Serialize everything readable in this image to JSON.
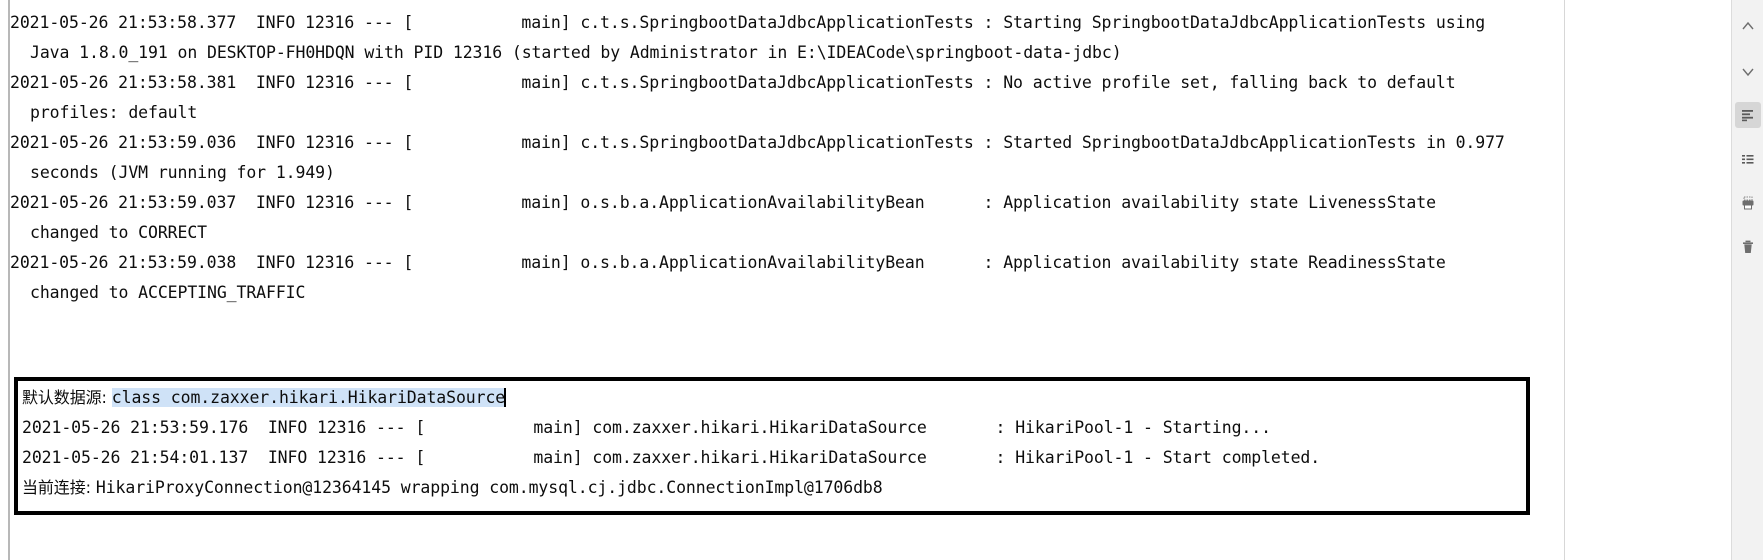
{
  "console": {
    "lines": [
      {
        "text": "2021-05-26 21:53:58.377  INFO 12316 --- [           main] c.t.s.SpringbootDataJdbcApplicationTests : Starting SpringbootDataJdbcApplicationTests using",
        "indent": false
      },
      {
        "text": "Java 1.8.0_191 on DESKTOP-FH0HDQN with PID 12316 (started by Administrator in E:\\IDEACode\\springboot-data-jdbc)",
        "indent": true
      },
      {
        "text": "2021-05-26 21:53:58.381  INFO 12316 --- [           main] c.t.s.SpringbootDataJdbcApplicationTests : No active profile set, falling back to default",
        "indent": false
      },
      {
        "text": "profiles: default",
        "indent": true
      },
      {
        "text": "2021-05-26 21:53:59.036  INFO 12316 --- [           main] c.t.s.SpringbootDataJdbcApplicationTests : Started SpringbootDataJdbcApplicationTests in 0.977",
        "indent": false
      },
      {
        "text": "seconds (JVM running for 1.949)",
        "indent": true
      },
      {
        "text": "2021-05-26 21:53:59.037  INFO 12316 --- [           main] o.s.b.a.ApplicationAvailabilityBean      : Application availability state LivenessState",
        "indent": false
      },
      {
        "text": "changed to CORRECT",
        "indent": true
      },
      {
        "text": "2021-05-26 21:53:59.038  INFO 12316 --- [           main] o.s.b.a.ApplicationAvailabilityBean      : Application availability state ReadinessState",
        "indent": false
      },
      {
        "text": "changed to ACCEPTING_TRAFFIC",
        "indent": true
      }
    ]
  },
  "boxed": {
    "datasource_label": "默认数据源: ",
    "datasource_value": "class com.zaxxer.hikari.HikariDataSource",
    "lines": [
      {
        "text": "2021-05-26 21:53:59.176  INFO 12316 --- [           main] com.zaxxer.hikari.HikariDataSource       : HikariPool-1 - Starting..."
      },
      {
        "text": "2021-05-26 21:54:01.137  INFO 12316 --- [           main] com.zaxxer.hikari.HikariDataSource       : HikariPool-1 - Start completed."
      }
    ],
    "connection_label": "当前连接: ",
    "connection_value": "HikariProxyConnection@12364145 wrapping com.mysql.cj.jdbc.ConnectionImpl@1706db8"
  },
  "toolbar": {
    "buttons": [
      {
        "name": "scroll-up-icon",
        "title": "Up the Stack Trace"
      },
      {
        "name": "scroll-down-icon",
        "title": "Down the Stack Trace"
      },
      {
        "name": "soft-wrap-icon",
        "title": "Soft-Wrap",
        "active": true
      },
      {
        "name": "list-lines-icon",
        "title": "Use Console Input"
      },
      {
        "name": "print-icon",
        "title": "Print"
      },
      {
        "name": "trash-icon",
        "title": "Clear All"
      }
    ]
  },
  "colors": {
    "text": "#0d0d0d",
    "selection": "#cfe2f7",
    "box_border": "#000000",
    "toolbar_bg": "#f2f2f2",
    "toolbar_active": "#d6d6d6"
  }
}
